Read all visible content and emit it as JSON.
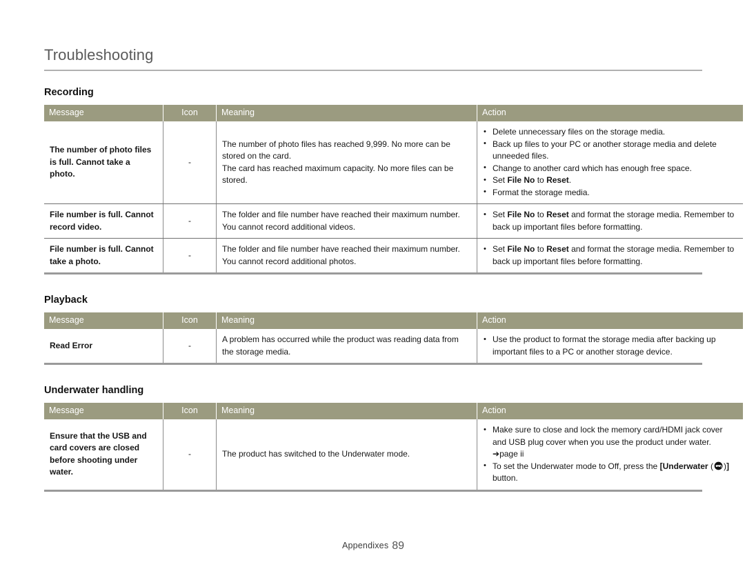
{
  "document": {
    "chapter_title": "Troubleshooting"
  },
  "table_headers": {
    "message": "Message",
    "icon": "Icon",
    "meaning": "Meaning",
    "action": "Action"
  },
  "sections": [
    {
      "heading": "Recording",
      "rows": [
        {
          "message": "The number of photo files is full. Cannot take a photo.",
          "icon": "-",
          "meaning_lines": [
            "The number of photo files has reached 9,999. No more can be stored on the card.",
            "The card has reached maximum capacity. No more files can be stored."
          ],
          "actions": [
            {
              "text": "Delete unnecessary files on the storage media."
            },
            {
              "text": "Back up files to your PC or another storage media and delete unneeded files."
            },
            {
              "text": "Change to another card which has enough free space."
            },
            {
              "pre": "Set ",
              "bold1": "File No",
              "mid": " to ",
              "bold2": "Reset",
              "post": "."
            },
            {
              "text": "Format the storage media."
            }
          ]
        },
        {
          "message": "File number is full. Cannot record video.",
          "icon": "-",
          "meaning_lines": [
            "The folder and file number have reached their maximum number. You cannot record additional videos."
          ],
          "actions": [
            {
              "pre": "Set ",
              "bold1": "File No",
              "mid": " to ",
              "bold2": "Reset",
              "post": " and format the storage media. Remember to back up important files before formatting."
            }
          ]
        },
        {
          "message": "File number is full. Cannot take a photo.",
          "icon": "-",
          "meaning_lines": [
            "The folder and file number have reached their maximum number. You cannot record additional photos."
          ],
          "actions": [
            {
              "pre": "Set ",
              "bold1": "File No",
              "mid": " to ",
              "bold2": "Reset",
              "post": " and format the storage media. Remember to back up important files before formatting."
            }
          ]
        }
      ]
    },
    {
      "heading": "Playback",
      "rows": [
        {
          "message": "Read Error",
          "icon": "-",
          "meaning_lines": [
            "A problem has occurred while the product was reading data from the storage media."
          ],
          "actions": [
            {
              "text": "Use the product to format the storage media after backing up important files to a PC or another storage device."
            }
          ]
        }
      ]
    },
    {
      "heading": "Underwater handling",
      "rows": [
        {
          "message": "Ensure that the USB and card covers are closed before shooting under water.",
          "icon": "-",
          "meaning_lines": [
            "The product has switched to the Underwater mode."
          ],
          "actions": [
            {
              "text": "Make sure to close and lock the memory card/HDMI jack cover and USB plug cover when you use the product under water. ",
              "ref_arrow": "➔",
              "ref_text": "page ii"
            },
            {
              "pre": "To set the Underwater mode to Off, press the ",
              "bracket_open": "[",
              "bold1": "Underwater",
              "paren_open": " (",
              "icon_name": "underwater-diving-mask-icon",
              "paren_close": ")",
              "bracket_close": "]",
              "post": " button."
            }
          ]
        }
      ]
    }
  ],
  "footer": {
    "label": "Appendixes",
    "page_number": "89"
  },
  "colors": {
    "header_band": "#9b9b80",
    "header_text": "#ffffff",
    "title_text": "#5a5a5a",
    "rule": "#b0b0b0"
  }
}
